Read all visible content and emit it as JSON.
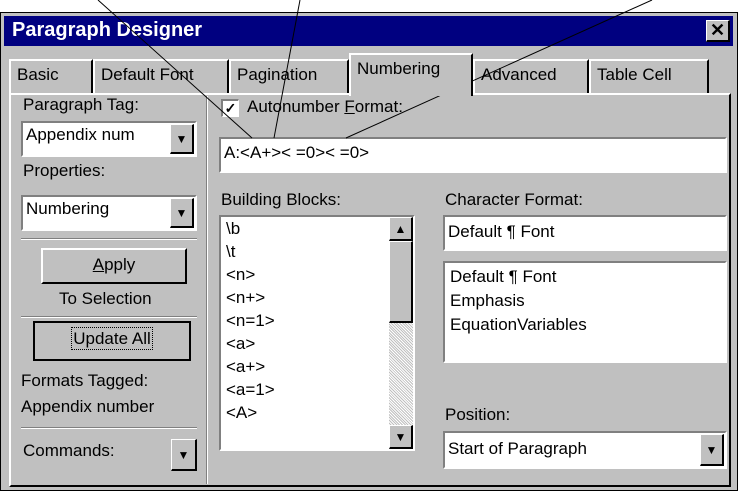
{
  "window": {
    "title": "Paragraph Designer",
    "close_label": "✕"
  },
  "tabs": [
    {
      "label": "Basic"
    },
    {
      "label": "Default Font"
    },
    {
      "label": "Pagination"
    },
    {
      "label": "Numbering"
    },
    {
      "label": "Advanced"
    },
    {
      "label": "Table Cell"
    }
  ],
  "left": {
    "paragraph_tag_label": "Paragraph Tag:",
    "paragraph_tag_value": "Appendix num",
    "properties_label": "Properties:",
    "properties_value": "Numbering",
    "apply_label": "Apply",
    "apply_mnemonic_rest": "pply",
    "apply_mnemonic": "A",
    "to_selection": "To Selection",
    "update_all_label": "Update All",
    "formats_tagged_label": "Formats Tagged:",
    "formats_tagged_value": "Appendix number",
    "commands_label": "Commands:"
  },
  "numbering": {
    "autonumber_checked": true,
    "autonumber_label_pre": "Autonumber ",
    "autonumber_label_u": "F",
    "autonumber_label_post": "ormat:",
    "format_value": "A:<A+>< =0>< =0>",
    "building_blocks_label": "Building Blocks:",
    "building_blocks": [
      "\\b",
      "\\t",
      "<n>",
      "<n+>",
      "<n=1>",
      "<a>",
      "<a+>",
      "<a=1>",
      "<A>"
    ],
    "character_format_label": "Character Format:",
    "character_format_value": "Default ¶ Font",
    "character_formats": [
      "Default ¶ Font",
      "Emphasis",
      "EquationVariables"
    ],
    "position_label": "Position:",
    "position_value": "Start of Paragraph"
  },
  "colors": {
    "titlebar": "#000080",
    "face": "#c0c0c0"
  },
  "icons": {
    "dropdown": "down-triangle",
    "scroll_up": "up-triangle",
    "scroll_down": "down-triangle",
    "check": "checkmark"
  }
}
